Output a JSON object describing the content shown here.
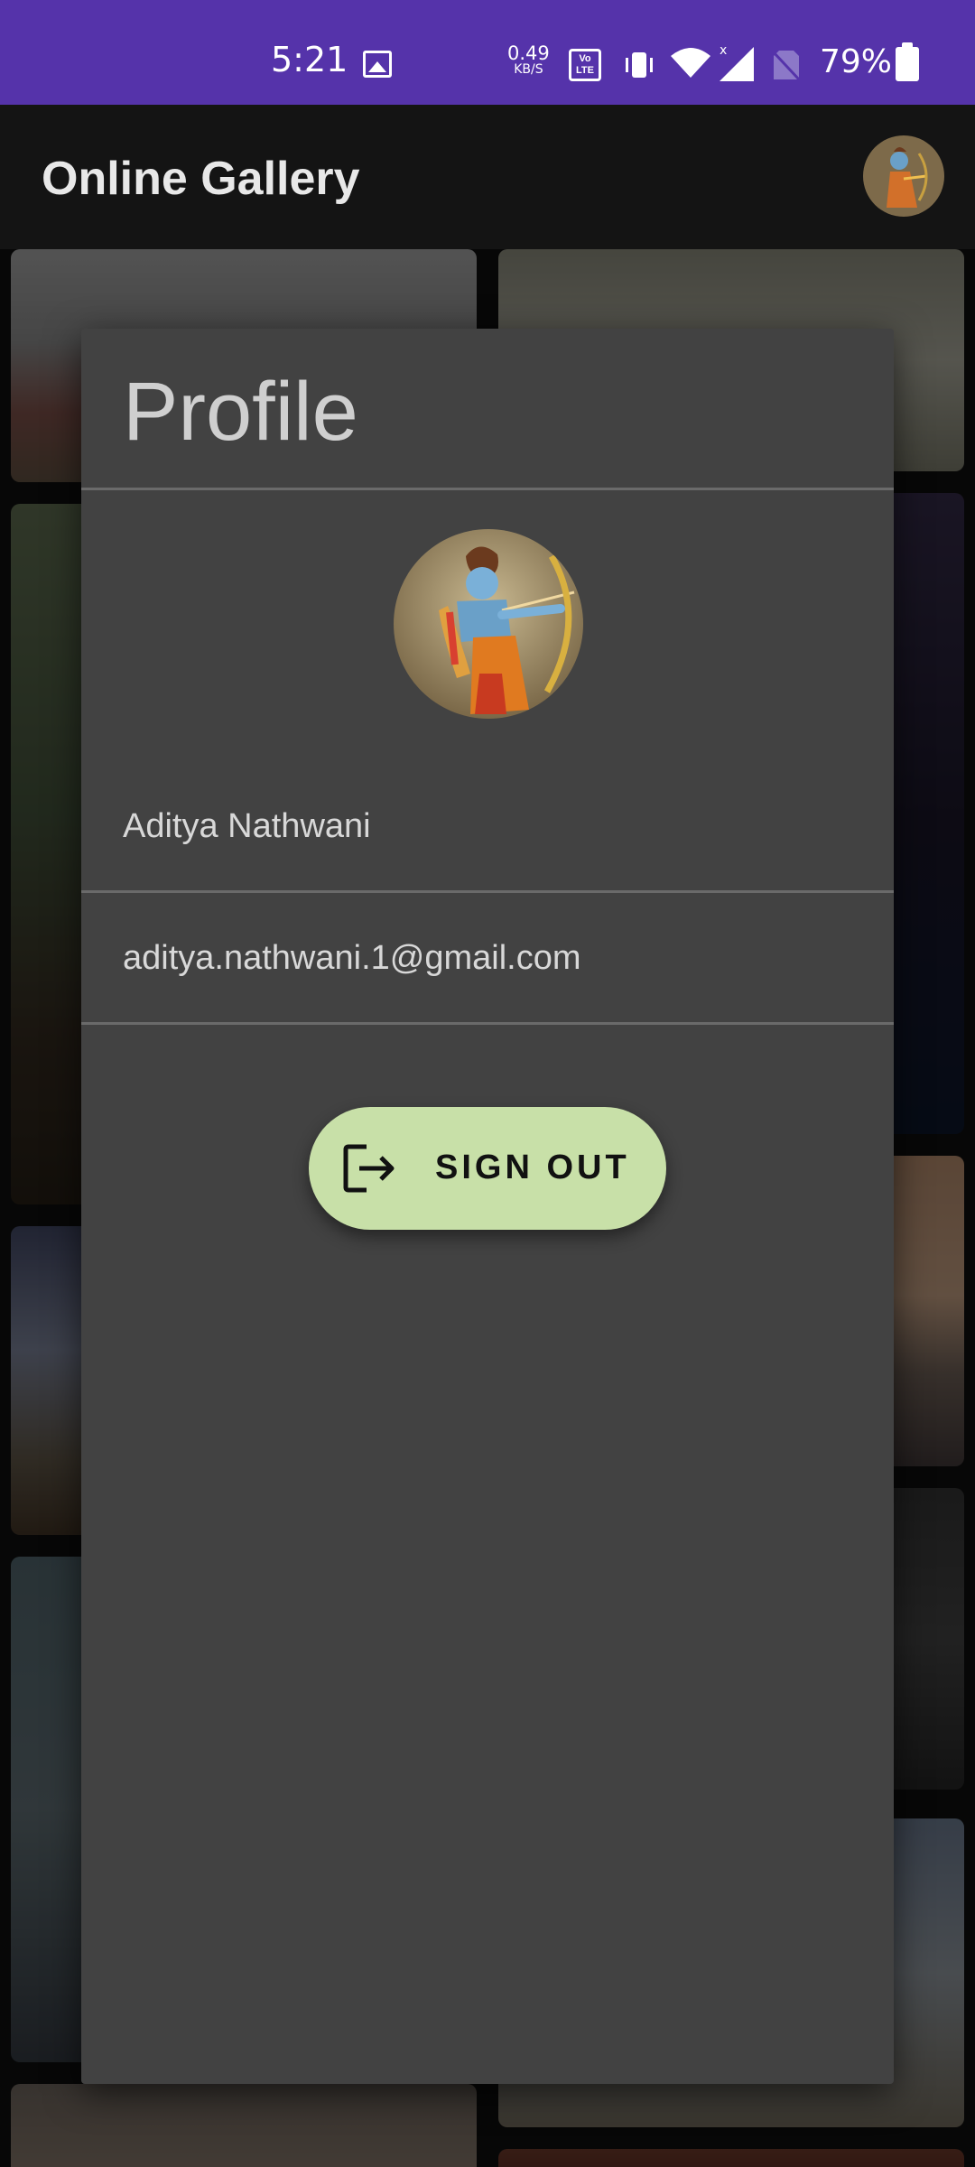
{
  "status_bar": {
    "time": "5:21",
    "net_speed_value": "0.49",
    "net_speed_unit": "KB/S",
    "volte_label": "Vo LTE",
    "battery_percent": "79%",
    "icons": [
      "image-icon",
      "volte-icon",
      "vibrate-icon",
      "wifi-icon",
      "signal-icon",
      "no-sim-icon",
      "battery-icon"
    ]
  },
  "app_bar": {
    "title": "Online Gallery"
  },
  "dialog": {
    "title": "Profile",
    "name": "Aditya Nathwani",
    "email": "aditya.nathwani.1@gmail.com",
    "sign_out_label": "SIGN OUT"
  },
  "colors": {
    "status_bar": "#5533aa",
    "app_bar": "#141414",
    "dialog": "#424242",
    "sign_out_button": "#c8e0a8"
  }
}
